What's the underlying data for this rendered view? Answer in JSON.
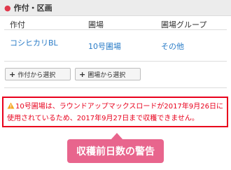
{
  "section": {
    "bullet": "●",
    "title": "作付・区画"
  },
  "table": {
    "headers": [
      "作付",
      "圃場",
      "圃場グループ"
    ],
    "row": {
      "crop": "コシヒカリBL",
      "field": "10号圃場",
      "group": "その他"
    }
  },
  "buttons": {
    "select_crop": "作付から選択",
    "select_field": "圃場から選択"
  },
  "warning": {
    "text": "10号圃場は、ラウンドアップマックスロードが2017年9月26日に使用されているため、2017年9月27日まで収穫できません。",
    "color": "#e8001c"
  },
  "callout": {
    "label": "収穫前日数の警告",
    "color": "#e8658d"
  }
}
